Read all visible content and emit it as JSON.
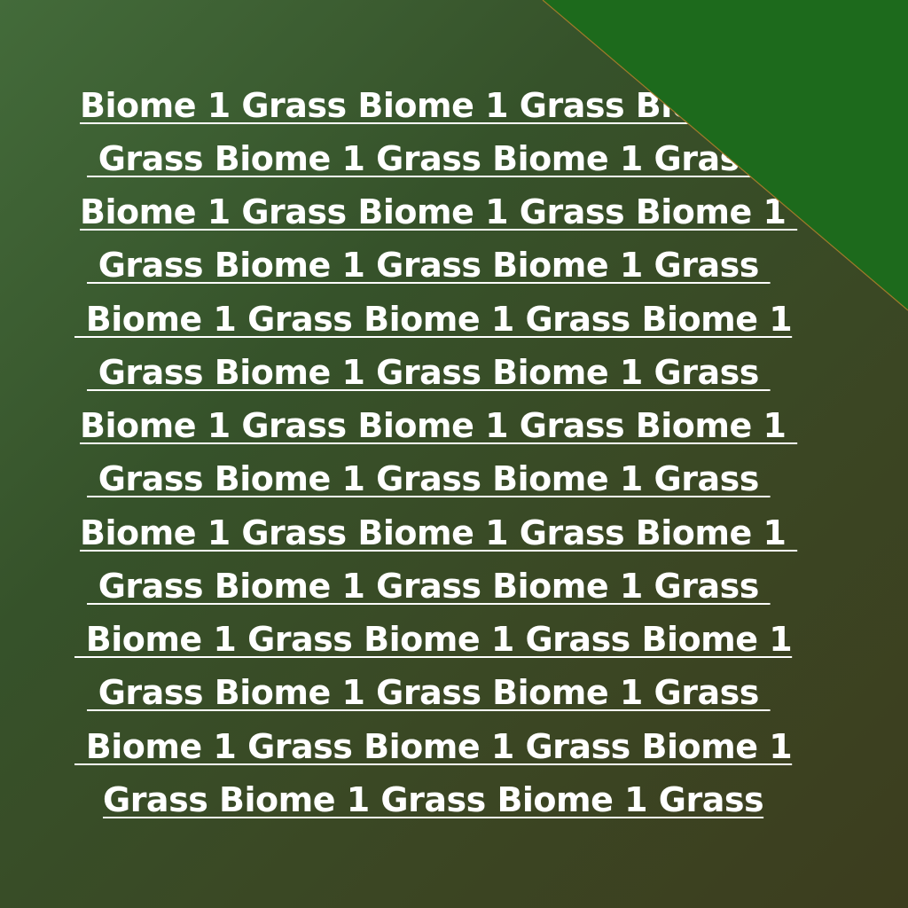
{
  "background": {
    "gradient_start": "#436b3a",
    "gradient_end": "#3c3d1e",
    "corner_color": "#1d6a1c",
    "corner_edge_color": "#a07a2a"
  },
  "lines": [
    "Biome 1 Grass Biome 1 Grass Biome 1",
    " Grass Biome 1 Grass Biome 1 Grass ",
    "Biome 1 Grass Biome 1 Grass Biome 1 ",
    " Grass Biome 1 Grass Biome 1 Grass ",
    " Biome 1 Grass Biome 1 Grass Biome 1",
    " Grass Biome 1 Grass Biome 1 Grass ",
    "Biome 1 Grass Biome 1 Grass Biome 1 ",
    " Grass Biome 1 Grass Biome 1 Grass ",
    "Biome 1 Grass Biome 1 Grass Biome 1 ",
    " Grass Biome 1 Grass Biome 1 Grass ",
    " Biome 1 Grass Biome 1 Grass Biome 1",
    " Grass Biome 1 Grass Biome 1 Grass ",
    " Biome 1 Grass Biome 1 Grass Biome 1",
    "Grass Biome 1 Grass Biome 1 Grass"
  ]
}
